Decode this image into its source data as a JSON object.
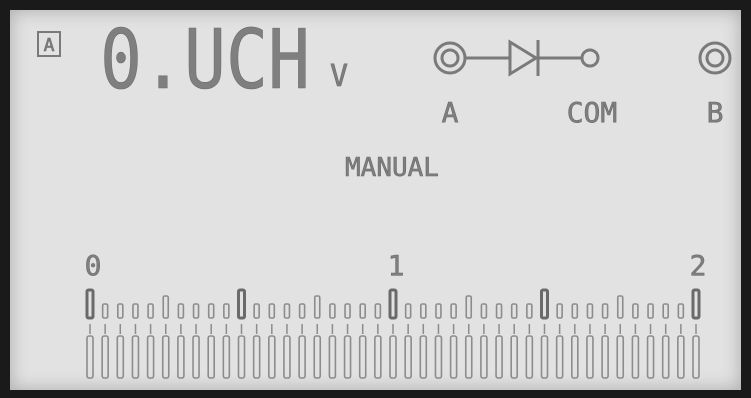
{
  "display": {
    "range_indicator": "A",
    "reading": "0.UCH",
    "unit": "V",
    "mode": "MANUAL"
  },
  "terminals": {
    "left_label": "A",
    "common_label": "COM",
    "right_label": "B"
  },
  "bargraph": {
    "scale_labels": [
      "0",
      "1",
      "2"
    ]
  },
  "colors": {
    "lcd_background": "#e2e2e2",
    "segment_color": "#8a8a8a",
    "frame": "#1a1a1a"
  }
}
